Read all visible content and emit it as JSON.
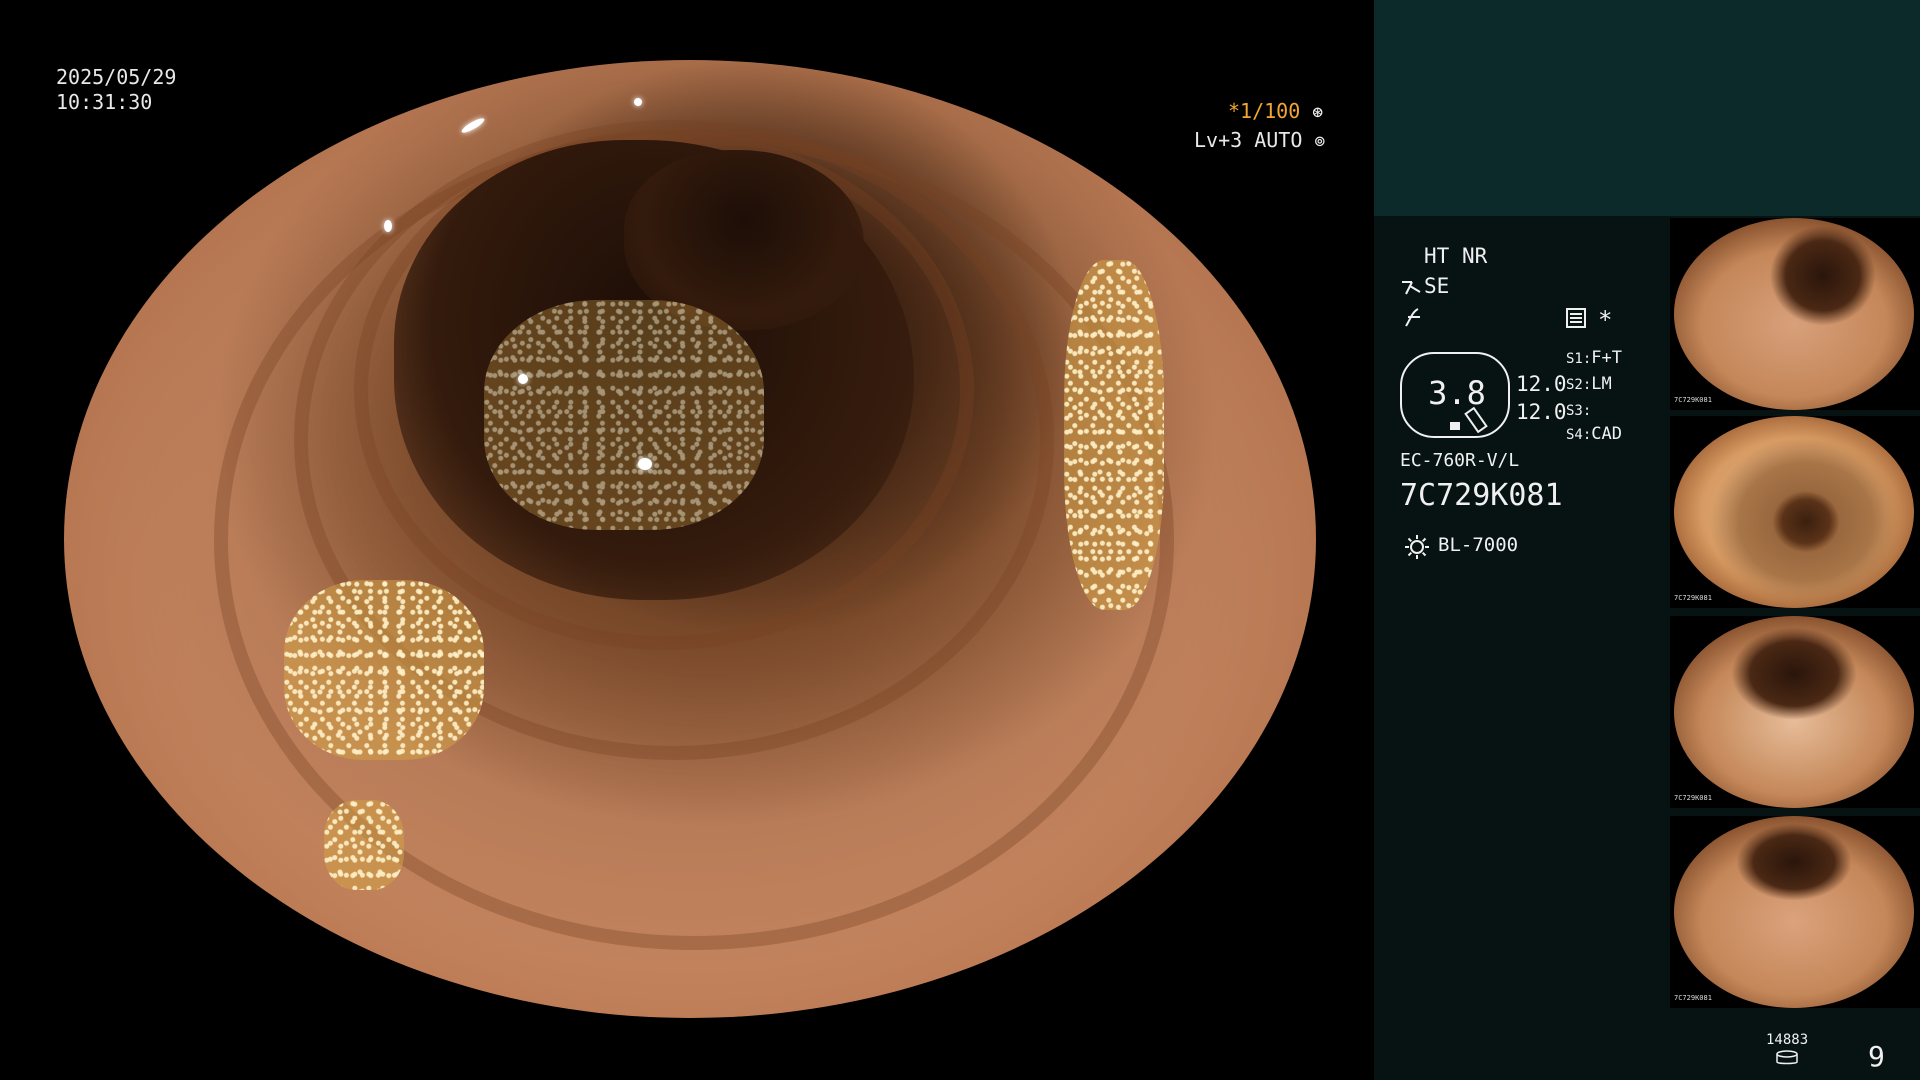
{
  "osd": {
    "date": "2025/05/29",
    "time": "10:31:30",
    "shutter": "*1/100",
    "shutter_icon": "aperture-icon",
    "iris": "Lv+3 AUTO",
    "iris_icon": "iris-icon"
  },
  "panel": {
    "ht_label": "HT",
    "nr_label": "NR",
    "se_label": "SE",
    "se_icon": "structure-enhance-icon",
    "color_icon": "color-mode-icon",
    "menu_icon": "menu-list-icon",
    "asterisk": "*",
    "scope_value": "3.8",
    "val1": "12.0",
    "val2": "12.0",
    "s1_label": "S1:",
    "s1_value": "F+T",
    "s2_label": "S2:",
    "s2_value": "LM",
    "s3_label": "S3:",
    "s3_value": "",
    "s4_label": "S4:",
    "s4_value": "CAD",
    "scope_model": "EC-760R-V/L",
    "scope_serial": "7C729K081",
    "lamp_icon": "light-source-icon",
    "light_source": "BL-7000",
    "storage_count": "14883",
    "storage_icon": "storage-disk-icon",
    "image_count": "9"
  },
  "thumbnails": [
    {
      "label": "7C729K081"
    },
    {
      "label": "7C729K081"
    },
    {
      "label": "7C729K081"
    },
    {
      "label": "7C729K081"
    }
  ],
  "colors": {
    "accent_orange": "#f2a531",
    "panel_top": "#0c2a2a",
    "panel_bottom": "#071313",
    "text": "#f0f0f0"
  }
}
